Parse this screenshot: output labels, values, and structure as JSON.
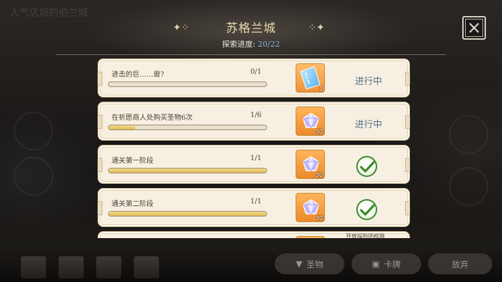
{
  "background": {
    "faint_title": "人气店城的伯兰城"
  },
  "header": {
    "title": "苏格兰城",
    "progress_label": "探索进度:",
    "progress_value": "20/22",
    "ornament_left": "✦⁘",
    "ornament_right": "⁘✦"
  },
  "tasks": [
    {
      "name": "进击的巨……兽?",
      "count": "0/1",
      "progress": 0,
      "reward_icon": "ticket-icon",
      "reward_qty": "1",
      "status": "进行中",
      "completed": false
    },
    {
      "name": "在祈愿商人处购买圣物6次",
      "count": "1/6",
      "progress": 0.167,
      "reward_icon": "diamond-icon",
      "reward_qty": "30",
      "status": "进行中",
      "completed": false
    },
    {
      "name": "通关第一阶段",
      "count": "1/1",
      "progress": 1,
      "reward_icon": "diamond-icon",
      "reward_qty": "30",
      "status": "",
      "completed": true
    },
    {
      "name": "通关第二阶段",
      "count": "1/1",
      "progress": 1,
      "reward_icon": "diamond-icon",
      "reward_qty": "30",
      "status": "",
      "completed": true
    },
    {
      "name": "",
      "count": "",
      "progress": 0,
      "reward_icon": "diamond-icon",
      "reward_qty": "",
      "status": "开放探险团权限",
      "completed": false
    }
  ],
  "bottom": {
    "relic_label": "圣物",
    "card_label": "卡牌",
    "abandon_label": "放弃"
  },
  "colors": {
    "status_text": "#4f6e85",
    "progress_value": "#7fb6e6",
    "bar_fill": "#e0ba52",
    "check": "#3c8a2c"
  }
}
